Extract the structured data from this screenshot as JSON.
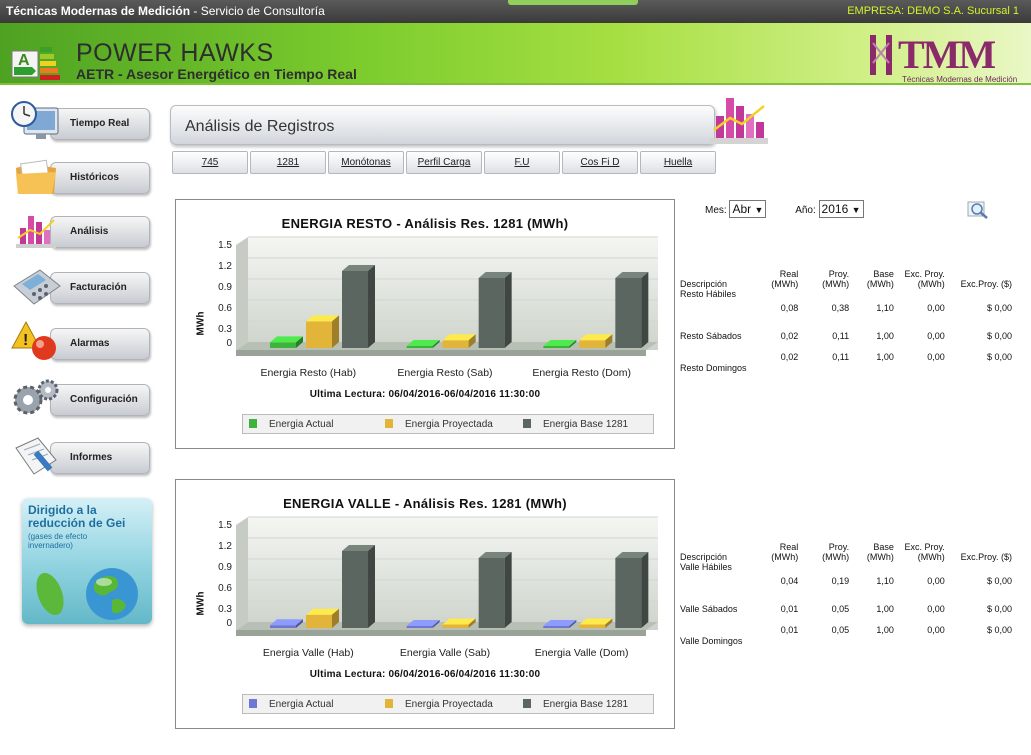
{
  "topbar": {
    "company": "Técnicas Modernas de Medición",
    "service": " - Servicio de Consultoría",
    "empresa": "EMPRESA: DEMO S.A. Sucursal 1"
  },
  "header": {
    "title": "POWER HAWKS",
    "subtitle": "AETR - Asesor Energético en Tiempo Real",
    "logo_text": "TMM",
    "logo_sub": "Técnicas Modernas de Medición"
  },
  "nav": [
    {
      "label": "Tiempo Real",
      "icon": "monitor-clock-icon"
    },
    {
      "label": "Históricos",
      "icon": "folder-icon"
    },
    {
      "label": "Análisis",
      "icon": "bar-chart-icon"
    },
    {
      "label": "Facturación",
      "icon": "calculator-icon"
    },
    {
      "label": "Alarmas",
      "icon": "alarm-icon"
    },
    {
      "label": "Configuración",
      "icon": "gears-icon"
    },
    {
      "label": "Informes",
      "icon": "clipboard-icon"
    }
  ],
  "gei": {
    "line1": "Dirigido a la",
    "line2": "reducción de Gei",
    "line3": "(gases de efecto",
    "line4": "invernadero)"
  },
  "panel": {
    "title": "Análisis de Registros"
  },
  "tabs": [
    "745",
    "1281",
    "Monótonas",
    "Perfil Carga",
    "F.U",
    "Cos Fi D",
    "Huella"
  ],
  "filters": {
    "mes_label": "Mes:",
    "mes_value": "Abr",
    "anio_label": "Año:",
    "anio_value": "2016"
  },
  "colors": {
    "actual_resto": "#3cb43c",
    "actual_valle": "#6e78d2",
    "proyectada": "#e2b43a",
    "base": "#5c6660"
  },
  "chart_data": [
    {
      "type": "bar",
      "title": "ENERGIA RESTO - Análisis Res. 1281 (MWh)",
      "ylabel": "MWh",
      "ylim": [
        0,
        1.5
      ],
      "yticks": [
        "1.5",
        "1.2",
        "0.9",
        "0.6",
        "0.3",
        "0"
      ],
      "categories": [
        "Energia Resto (Hab)",
        "Energia Resto (Sab)",
        "Energia Resto (Dom)"
      ],
      "series": [
        {
          "name": "Energia Actual",
          "values": [
            0.08,
            0.02,
            0.02
          ]
        },
        {
          "name": "Energia Proyectada",
          "values": [
            0.38,
            0.11,
            0.11
          ]
        },
        {
          "name": "Energia Base 1281",
          "values": [
            1.1,
            1.0,
            1.0
          ]
        }
      ],
      "footer": "Ultima Lectura: 06/04/2016-06/04/2016 11:30:00",
      "legend": "bottom"
    },
    {
      "type": "bar",
      "title": "ENERGIA VALLE - Análisis Res. 1281 (MWh)",
      "ylabel": "MWh",
      "ylim": [
        0,
        1.5
      ],
      "yticks": [
        "1.5",
        "1.2",
        "0.9",
        "0.6",
        "0.3",
        "0"
      ],
      "categories": [
        "Energia Valle (Hab)",
        "Energia Valle (Sab)",
        "Energia Valle (Dom)"
      ],
      "series": [
        {
          "name": "Energia Actual",
          "values": [
            0.04,
            0.01,
            0.01
          ]
        },
        {
          "name": "Energia Proyectada",
          "values": [
            0.19,
            0.05,
            0.05
          ]
        },
        {
          "name": "Energia Base 1281",
          "values": [
            1.1,
            1.0,
            1.0
          ]
        }
      ],
      "footer": "Ultima Lectura: 06/04/2016-06/04/2016 11:30:00",
      "legend": "bottom"
    }
  ],
  "table_resto": {
    "headers": [
      "Descripción",
      "Real (MWh)",
      "Proy. (MWh)",
      "Base (MWh)",
      "Exc. Proy. (MWh)",
      "Exc.Proy. ($)"
    ],
    "rows": [
      [
        "Resto Hábiles",
        "0,08",
        "0,38",
        "1,10",
        "0,00",
        "$ 0,00"
      ],
      [
        "Resto Sábados",
        "0,02",
        "0,11",
        "1,00",
        "0,00",
        "$ 0,00"
      ],
      [
        "Resto Domingos",
        "0,02",
        "0,11",
        "1,00",
        "0,00",
        "$ 0,00"
      ]
    ]
  },
  "table_valle": {
    "headers": [
      "Descripción",
      "Real (MWh)",
      "Proy. (MWh)",
      "Base (MWh)",
      "Exc. Proy. (MWh)",
      "Exc.Proy. ($)"
    ],
    "rows": [
      [
        "Valle Hábiles",
        "0,04",
        "0,19",
        "1,10",
        "0,00",
        "$ 0,00"
      ],
      [
        "Valle Sábados",
        "0,01",
        "0,05",
        "1,00",
        "0,00",
        "$ 0,00"
      ],
      [
        "Valle Domingos",
        "0,01",
        "0,05",
        "1,00",
        "0,00",
        "$ 0,00"
      ]
    ]
  }
}
